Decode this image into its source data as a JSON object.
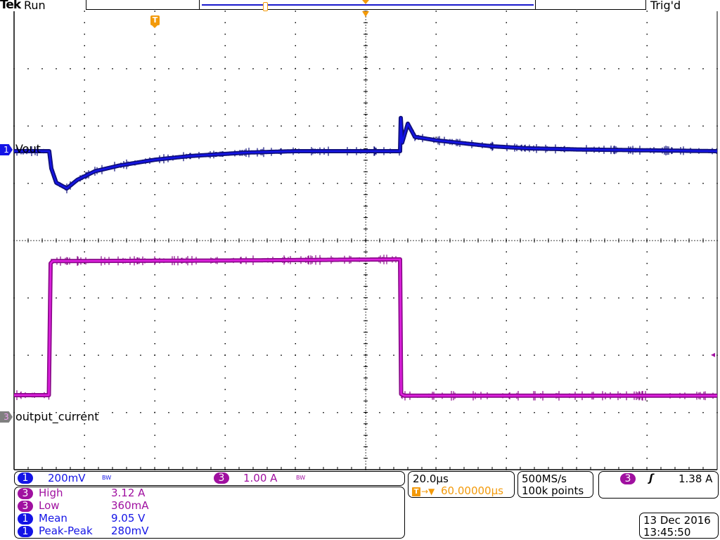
{
  "header": {
    "brand": "Tek",
    "acq_state": "Run",
    "trigger_state": "Trig'd"
  },
  "colors": {
    "ch1": "#1414e6",
    "ch3": "#a010a0",
    "trigger": "#f39a0a",
    "grid": "#000000"
  },
  "channels": {
    "ch1": {
      "number": "1",
      "label": "Vout",
      "scale": "200mV",
      "bw_icon": "BW"
    },
    "ch3": {
      "number": "3",
      "label": "output_current",
      "scale": "1.00 A",
      "bw_icon": "BW"
    }
  },
  "measurements": [
    {
      "ch": "3",
      "name": "High",
      "value": "3.12 A"
    },
    {
      "ch": "3",
      "name": "Low",
      "value": "360mA"
    },
    {
      "ch": "1",
      "name": "Mean",
      "value": "9.05 V"
    },
    {
      "ch": "1",
      "name": "Peak-Peak",
      "value": "280mV"
    }
  ],
  "timebase": {
    "scale": "20.0µs",
    "position": "60.00000µs",
    "position_prefix": "→▼"
  },
  "acquisition": {
    "sample_rate": "500MS/s",
    "record_length": "100k points"
  },
  "trigger": {
    "source": "3",
    "slope_icon": "rising-edge-icon",
    "slope_glyph": "ʃ",
    "level": "1.38 A",
    "marker": "T"
  },
  "datetime": {
    "date": "13 Dec  2016",
    "time": "13:45:50"
  },
  "chart_data": {
    "type": "line",
    "grid": true,
    "divisions": {
      "horizontal": 10,
      "vertical": 8
    },
    "x_unit": "µs",
    "xlim": [
      -10,
      190
    ],
    "series": [
      {
        "name": "Vout",
        "unit": "V",
        "volts_per_div": 0.2,
        "t": [
          -10,
          0,
          0.6,
          2,
          5,
          8,
          13,
          20,
          30,
          40,
          56,
          70,
          99.8,
          100,
          100.4,
          102,
          104,
          110,
          116,
          126,
          136,
          150,
          190
        ],
        "values": [
          9.05,
          9.05,
          8.99,
          8.94,
          8.92,
          8.95,
          8.98,
          9.0,
          9.02,
          9.033,
          9.045,
          9.05,
          9.05,
          9.166,
          9.08,
          9.146,
          9.1,
          9.088,
          9.08,
          9.067,
          9.06,
          9.056,
          9.05
        ]
      },
      {
        "name": "output_current",
        "unit": "A",
        "amps_per_div": 1.0,
        "t": [
          -10,
          -0.1,
          0.4,
          1,
          50,
          99.8,
          100.1,
          101,
          190
        ],
        "values": [
          0.38,
          0.38,
          2.68,
          2.72,
          2.73,
          2.75,
          0.4,
          0.37,
          0.37
        ]
      }
    ]
  }
}
